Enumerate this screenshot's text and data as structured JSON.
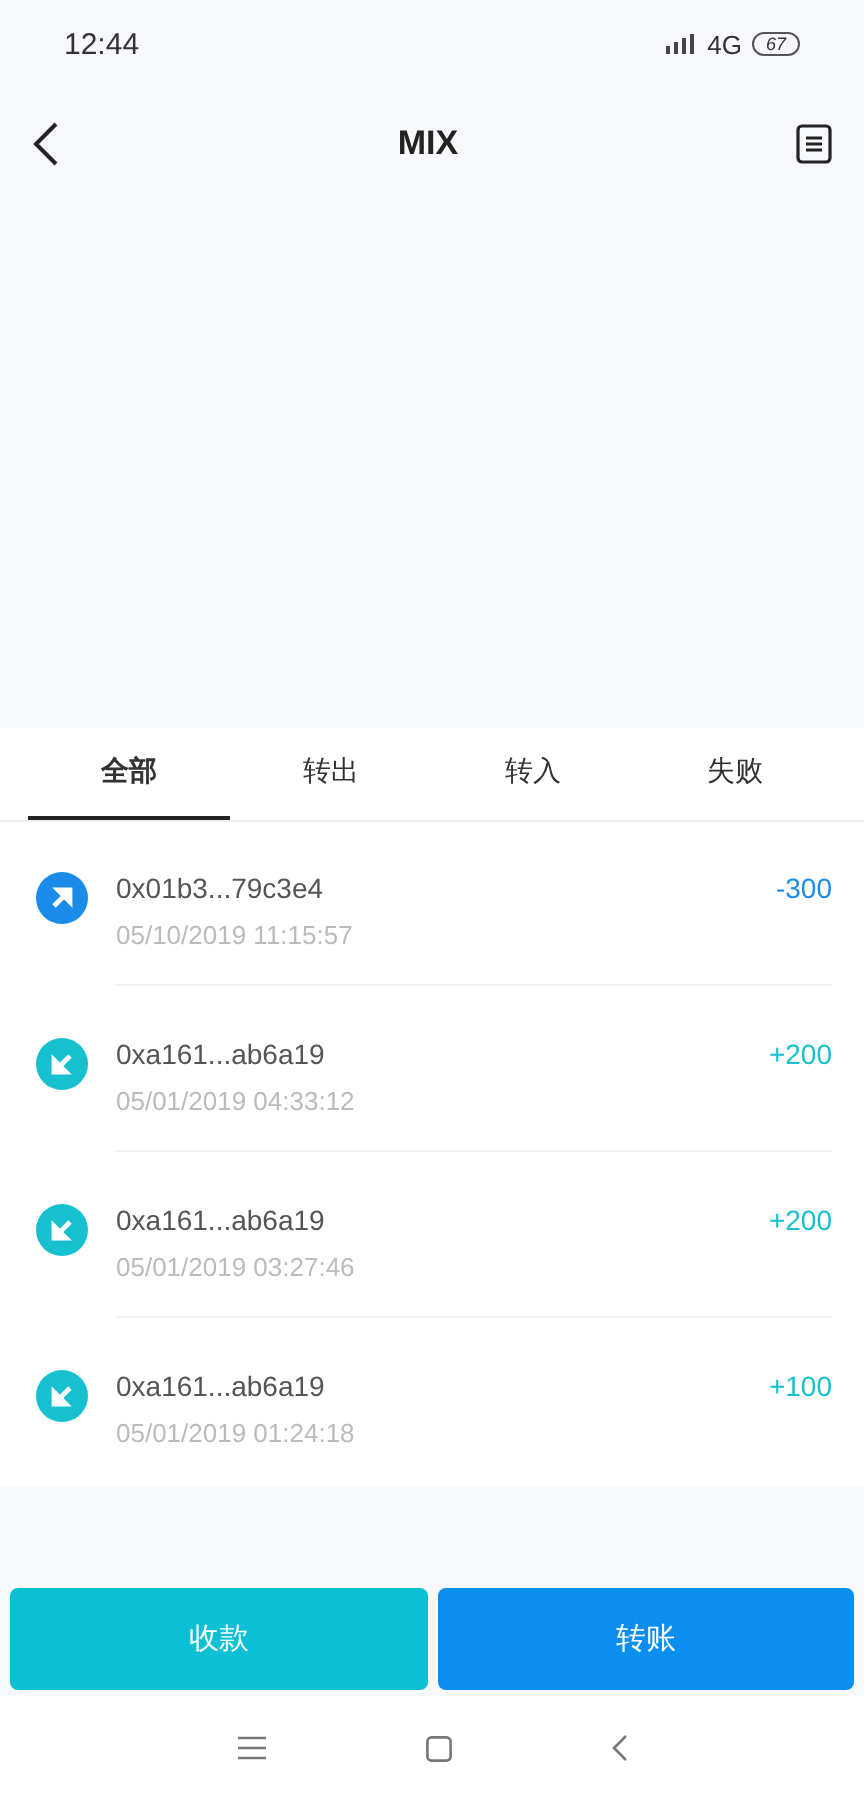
{
  "status_bar": {
    "time": "12:44",
    "network": "4G",
    "battery": "67"
  },
  "header": {
    "title": "MIX"
  },
  "tabs": [
    {
      "label": "全部",
      "selected": true
    },
    {
      "label": "转出",
      "selected": false
    },
    {
      "label": "转入",
      "selected": false
    },
    {
      "label": "失败",
      "selected": false
    }
  ],
  "transactions": [
    {
      "kind": "out",
      "address": "0x01b3...79c3e4",
      "time": "05/10/2019 11:15:57",
      "amount": "-300"
    },
    {
      "kind": "in",
      "address": "0xa161...ab6a19",
      "time": "05/01/2019 04:33:12",
      "amount": "+200"
    },
    {
      "kind": "in",
      "address": "0xa161...ab6a19",
      "time": "05/01/2019 03:27:46",
      "amount": "+200"
    },
    {
      "kind": "in",
      "address": "0xa161...ab6a19",
      "time": "05/01/2019 01:24:18",
      "amount": "+100"
    }
  ],
  "buttons": [
    {
      "kind": "receive",
      "label": "收款"
    },
    {
      "kind": "send",
      "label": "转账"
    }
  ]
}
